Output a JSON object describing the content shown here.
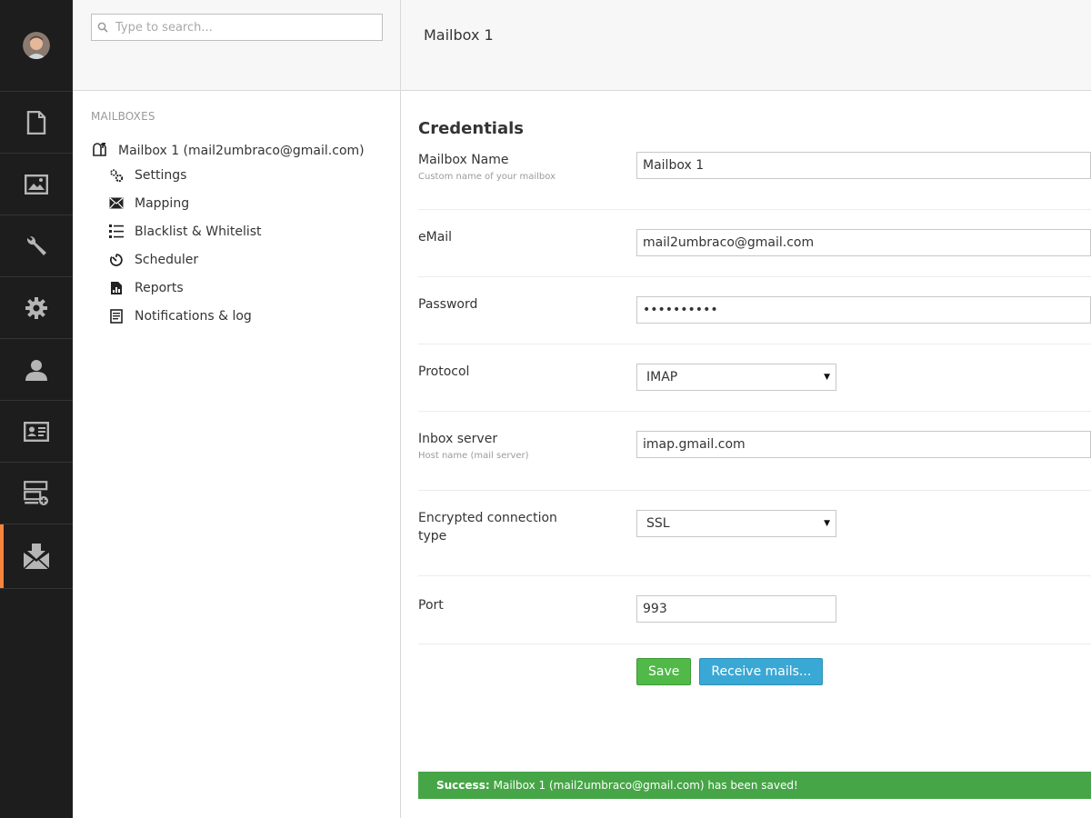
{
  "search": {
    "placeholder": "Type to search..."
  },
  "tree": {
    "section_title": "MAILBOXES",
    "root_label": "Mailbox 1 (mail2umbraco@gmail.com)",
    "children": [
      {
        "label": "Settings",
        "icon": "cogs-icon"
      },
      {
        "label": "Mapping",
        "icon": "envelope-icon"
      },
      {
        "label": "Blacklist & Whitelist",
        "icon": "list-icon"
      },
      {
        "label": "Scheduler",
        "icon": "timer-icon"
      },
      {
        "label": "Reports",
        "icon": "report-icon"
      },
      {
        "label": "Notifications & log",
        "icon": "log-icon"
      }
    ]
  },
  "rail": {
    "items": [
      "content-icon",
      "media-icon",
      "developer-icon",
      "settings-icon",
      "users-icon",
      "members-icon",
      "forms-icon",
      "mail-download-icon"
    ],
    "active_color": "#f5843c"
  },
  "header": {
    "title": "Mailbox 1"
  },
  "form": {
    "section_title": "Credentials",
    "mailbox_name": {
      "label": "Mailbox Name",
      "desc": "Custom name of your mailbox",
      "value": "Mailbox 1"
    },
    "email": {
      "label": "eMail",
      "value": "mail2umbraco@gmail.com"
    },
    "password": {
      "label": "Password",
      "value": "••••••••••"
    },
    "protocol": {
      "label": "Protocol",
      "value": "IMAP"
    },
    "inbox_server": {
      "label": "Inbox server",
      "desc": "Host name (mail server)",
      "value": "imap.gmail.com"
    },
    "encryption": {
      "label": "Encrypted connection type",
      "value": "SSL"
    },
    "port": {
      "label": "Port",
      "value": "993"
    },
    "save_label": "Save",
    "receive_label": "Receive mails..."
  },
  "notification": {
    "strong": "Success:",
    "text": "Mailbox 1 (mail2umbraco@gmail.com) has been saved!"
  }
}
